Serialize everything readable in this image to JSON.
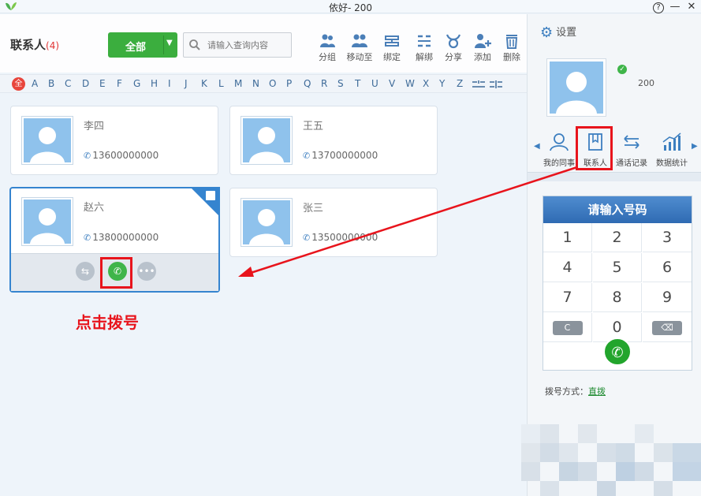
{
  "window": {
    "title": "依好- 200",
    "help_glyph": "?",
    "minimize_glyph": "—",
    "close_glyph": "✕"
  },
  "toolbar": {
    "contacts_title": "联系人",
    "contacts_count": "(4)",
    "filter_label": "全部",
    "search_placeholder": "请输入查询内容",
    "tools": [
      {
        "label": "分组",
        "icon": "group-icon"
      },
      {
        "label": "移动至",
        "icon": "move-icon"
      },
      {
        "label": "绑定",
        "icon": "bind-icon"
      },
      {
        "label": "解绑",
        "icon": "unbind-icon"
      },
      {
        "label": "分享",
        "icon": "share-icon"
      },
      {
        "label": "添加",
        "icon": "add-user-icon"
      },
      {
        "label": "删除",
        "icon": "trash-icon"
      }
    ]
  },
  "alphabet": {
    "all_label": "全",
    "letters": [
      "A",
      "B",
      "C",
      "D",
      "E",
      "F",
      "G",
      "H",
      "I",
      "J",
      "K",
      "L",
      "M",
      "N",
      "O",
      "P",
      "Q",
      "R",
      "S",
      "T",
      "U",
      "V",
      "W",
      "X",
      "Y",
      "Z"
    ]
  },
  "contacts": [
    {
      "name": "李四",
      "phone": "13600000000"
    },
    {
      "name": "王五",
      "phone": "13700000000"
    },
    {
      "name": "赵六",
      "phone": "13800000000"
    },
    {
      "name": "张三",
      "phone": "13500000000"
    }
  ],
  "annotation": {
    "label": "点击拨号"
  },
  "right_panel": {
    "settings_label": "设置",
    "extension": "200",
    "nav": [
      {
        "label": "我的同事",
        "icon": "colleague-icon"
      },
      {
        "label": "联系人",
        "icon": "contacts-book-icon"
      },
      {
        "label": "通话记录",
        "icon": "call-log-icon"
      },
      {
        "label": "数据统计",
        "icon": "stats-icon"
      }
    ],
    "dialpad_title": "请输入号码",
    "keys": [
      "1",
      "2",
      "3",
      "4",
      "5",
      "6",
      "7",
      "8",
      "9",
      "C",
      "0",
      "⌫"
    ],
    "dial_mode_label": "拨号方式：",
    "dial_mode_value": "直拨"
  },
  "colors": {
    "accent": "#3584cf",
    "green": "#3bae3e",
    "annotation_red": "#e8141c"
  }
}
